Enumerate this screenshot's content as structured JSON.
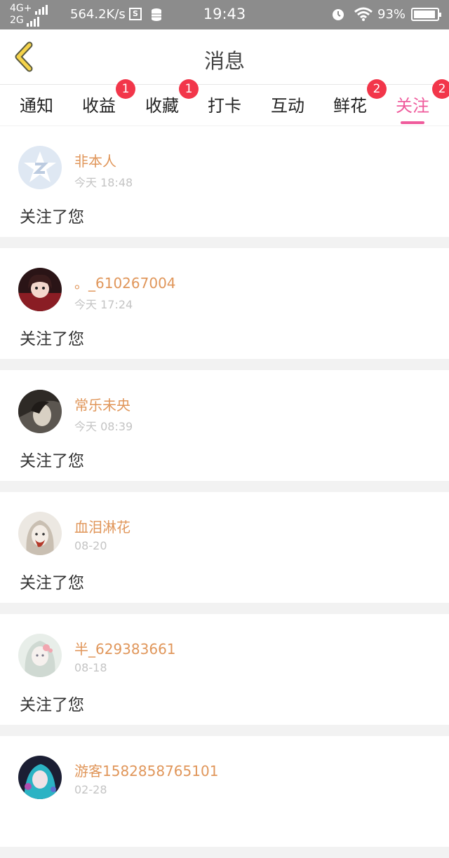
{
  "status_bar": {
    "network_1": "4G+",
    "network_2": "2G",
    "speed": "564.2K/s",
    "s_icon_label": "S",
    "time": "19:43",
    "battery_percent": "93%",
    "battery_level": 0.93
  },
  "header": {
    "title": "消息",
    "back_icon": "chevron-left-icon"
  },
  "colors": {
    "accent_pink": "#ef5b9c",
    "badge_red": "#f2364a",
    "name_orange": "#e0965a",
    "back_icon_yellow": "#f5d34a"
  },
  "tabs": [
    {
      "label": "通知",
      "badge": null,
      "active": false
    },
    {
      "label": "收益",
      "badge": "1",
      "active": false
    },
    {
      "label": "收藏",
      "badge": "1",
      "active": false
    },
    {
      "label": "打卡",
      "badge": null,
      "active": false
    },
    {
      "label": "互动",
      "badge": null,
      "active": false
    },
    {
      "label": "鲜花",
      "badge": "2",
      "active": false
    },
    {
      "label": "关注",
      "badge": "2",
      "active": true
    }
  ],
  "notifications": [
    {
      "name": "非本人",
      "time": "今天 18:48",
      "message": "关注了您",
      "avatar": "default-z-avatar"
    },
    {
      "name": "。_610267004",
      "time": "今天 17:24",
      "message": "关注了您",
      "avatar": "photo-avatar"
    },
    {
      "name": "常乐未央",
      "time": "今天 08:39",
      "message": "关注了您",
      "avatar": "photo-avatar"
    },
    {
      "name": "血泪淋花",
      "time": "08-20",
      "message": "关注了您",
      "avatar": "photo-avatar"
    },
    {
      "name": "半_629383661",
      "time": "08-18",
      "message": "关注了您",
      "avatar": "photo-avatar"
    },
    {
      "name": "游客1582858765101",
      "time": "02-28",
      "message": "",
      "avatar": "photo-avatar"
    }
  ]
}
